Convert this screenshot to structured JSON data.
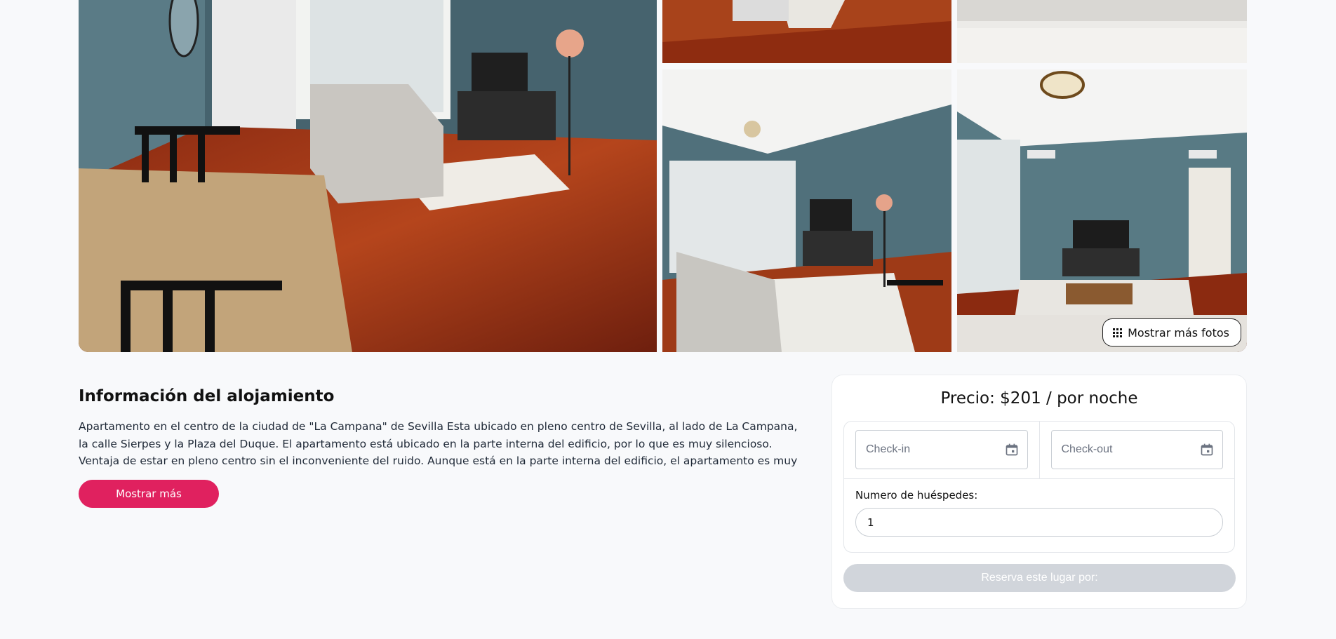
{
  "gallery": {
    "more_photos_label": "Mostrar más fotos"
  },
  "listing": {
    "title": "Información del alojamiento",
    "description": "Apartamento en el centro de la ciudad de \"La Campana\" de Sevilla Esta ubicado en pleno centro de Sevilla, al lado de La Campana, la calle Sierpes y la Plaza del Duque. El apartamento está ubicado en la parte interna del edificio, por lo que es muy silencioso. Ventaja de estar en pleno centro sin el inconveniente del ruido. Aunque está en la parte interna del edificio, el apartamento es muy luminoso ya que las ventanas...",
    "show_more_label": "Mostrar más"
  },
  "booking": {
    "price_text": "Precio: $201 / por noche",
    "checkin_placeholder": "Check-in",
    "checkout_placeholder": "Check-out",
    "guests_label": "Numero de huéspedes:",
    "guests_value": "1",
    "reserve_label": "Reserva este lugar por:"
  },
  "colors": {
    "accent": "#e0215f",
    "disabled": "#d1d5db",
    "background": "#f8f9fb"
  },
  "icons": [
    "grid-dots-icon",
    "calendar-icon"
  ]
}
